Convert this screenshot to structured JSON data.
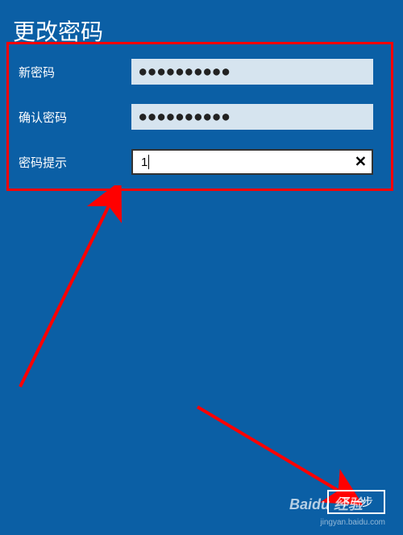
{
  "title": "更改密码",
  "form": {
    "new_password": {
      "label": "新密码",
      "masked": "●●●●●●●●●●"
    },
    "confirm_password": {
      "label": "确认密码",
      "masked": "●●●●●●●●●●"
    },
    "hint": {
      "label": "密码提示",
      "value": "1"
    }
  },
  "next_button": "下一步",
  "watermark": {
    "brand": "Baidu 经验",
    "url": "jingyan.baidu.com"
  }
}
